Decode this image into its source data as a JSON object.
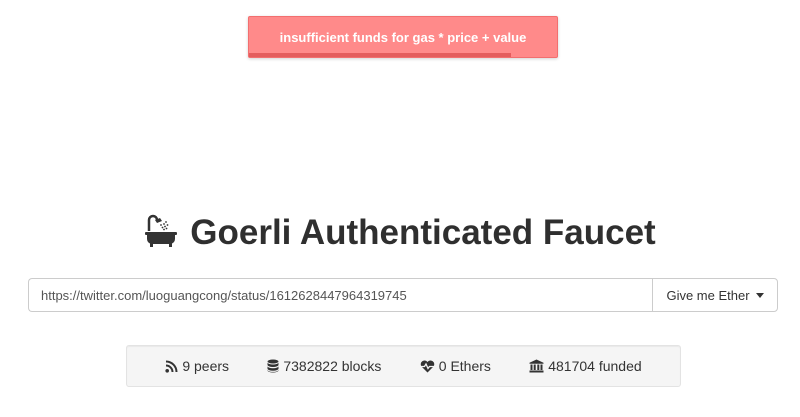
{
  "toast": {
    "message": "insufficient funds for gas * price + value",
    "progress": 0.85,
    "color": "#ff8a8a"
  },
  "header": {
    "icon": "bath-icon",
    "title": "Goerli Authenticated Faucet"
  },
  "request": {
    "url_value": "https://twitter.com/luoguangcong/status/1612628447964319745",
    "button_label": "Give me Ether"
  },
  "stats": {
    "peers": "9 peers",
    "blocks": "7382822 blocks",
    "ethers": "0 Ethers",
    "funded": "481704 funded"
  }
}
